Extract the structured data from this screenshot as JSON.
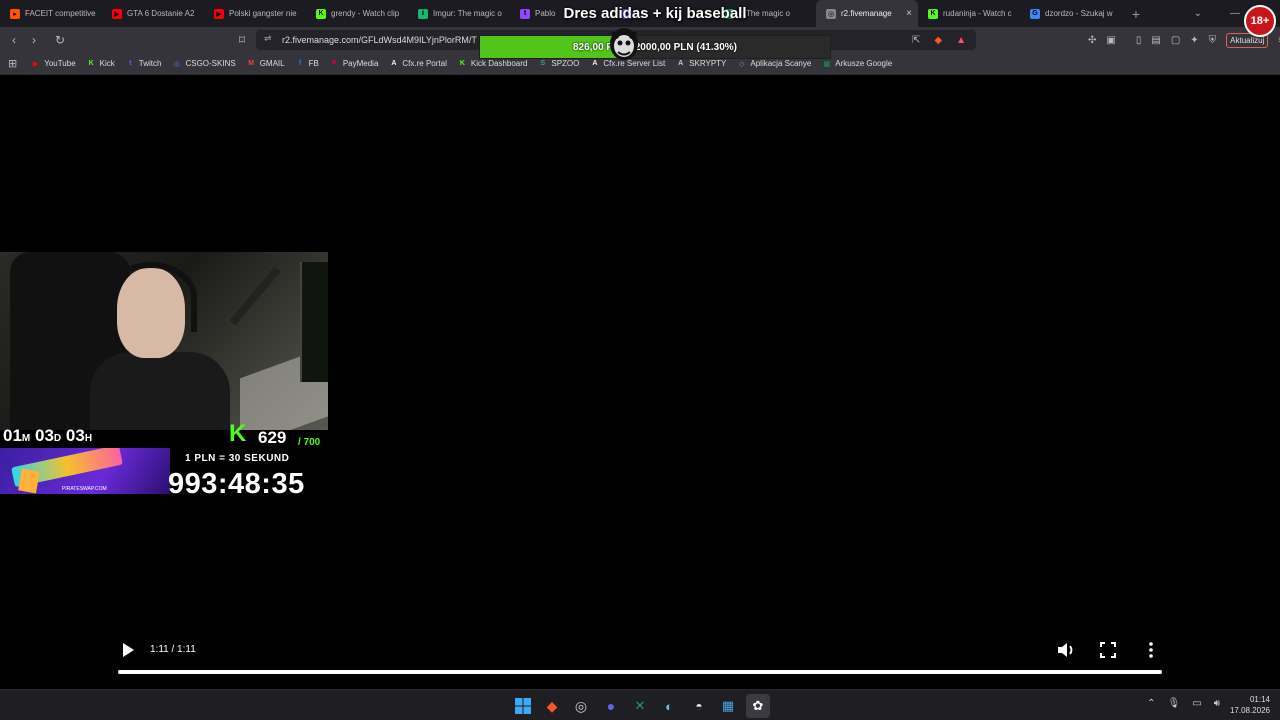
{
  "tabs": [
    {
      "title": "FACEIT competitive",
      "fav_color": "#ff5500",
      "fav_glyph": "▸"
    },
    {
      "title": "GTA 6 Dostanie A2",
      "fav_color": "#ff0000",
      "fav_glyph": "▶"
    },
    {
      "title": "Polski gangster nie",
      "fav_color": "#ff0000",
      "fav_glyph": "▶"
    },
    {
      "title": "grendy - Watch clip",
      "fav_color": "#53fc18",
      "fav_glyph": "K"
    },
    {
      "title": "Imgur: The magic o",
      "fav_color": "#1bb76e",
      "fav_glyph": "i"
    },
    {
      "title": "Pablo",
      "fav_color": "#9146ff",
      "fav_glyph": "t"
    },
    {
      "title": "",
      "fav_color": "#9146ff",
      "fav_glyph": "t"
    },
    {
      "title": "r: The magic o",
      "fav_color": "#1bb76e",
      "fav_glyph": "i"
    },
    {
      "title": "r2.fivemanage",
      "fav_color": "#888888",
      "fav_glyph": "◎",
      "active": true
    },
    {
      "title": "rudaninja - Watch c",
      "fav_color": "#53fc18",
      "fav_glyph": "K"
    },
    {
      "title": "dzordzo - Szukaj w",
      "fav_color": "#4285f4",
      "fav_glyph": "G"
    }
  ],
  "address": {
    "url": "r2.fivemanage.com/GFLdWsd4M9ILYjnPlorRM/T",
    "update_label": "Aktualizuj"
  },
  "bookmarks": [
    {
      "label": "YouTube",
      "color": "#ff0000",
      "glyph": "▶"
    },
    {
      "label": "Kick",
      "color": "#53fc18",
      "glyph": "K"
    },
    {
      "label": "Twitch",
      "color": "#9146ff",
      "glyph": "t"
    },
    {
      "label": "CSGO-SKINS",
      "color": "#3b82f6",
      "glyph": "◎"
    },
    {
      "label": "GMAIL",
      "color": "#ea4335",
      "glyph": "M"
    },
    {
      "label": "FB",
      "color": "#1877f2",
      "glyph": "f"
    },
    {
      "label": "PayMedia",
      "color": "#e6003a",
      "glyph": "P"
    },
    {
      "label": "Cfx.re Portal",
      "color": "#eeeeee",
      "glyph": "A"
    },
    {
      "label": "Kick Dashboard",
      "color": "#53fc18",
      "glyph": "K"
    },
    {
      "label": "SPZOO",
      "color": "#3aa3a3",
      "glyph": "S"
    },
    {
      "label": "Cfx.re Server List",
      "color": "#eeeeee",
      "glyph": "A"
    },
    {
      "label": "SKRYPTY",
      "color": "#cccccc",
      "glyph": "A"
    },
    {
      "label": "Aplikacja Scanye",
      "color": "#8899aa",
      "glyph": "◇"
    },
    {
      "label": "Arkusze Google",
      "color": "#0f9d58",
      "glyph": "▦"
    }
  ],
  "overlay": {
    "donation_title": "Dres adidas + kij baseball",
    "donation_text": "826,00 PLN / 2000,00 PLN (41.30%)",
    "donation_progress": 0.413,
    "age_badge": "18+",
    "timer_months": "01",
    "timer_months_unit": "M",
    "timer_days": "03",
    "timer_days_unit": "D",
    "timer_hours": "03",
    "timer_hours_unit": "H",
    "kick_followers": "629",
    "kick_goal": "/ 700",
    "rate_text": "1 PLN = 30 SEKUND",
    "countdown": "993:48:35",
    "banner_brand": "PIRATESWAP.COM"
  },
  "video": {
    "time": "1:11 / 1:11",
    "progress": 1.0
  },
  "clock": {
    "time": "01:14",
    "date": "17.08.2026"
  }
}
